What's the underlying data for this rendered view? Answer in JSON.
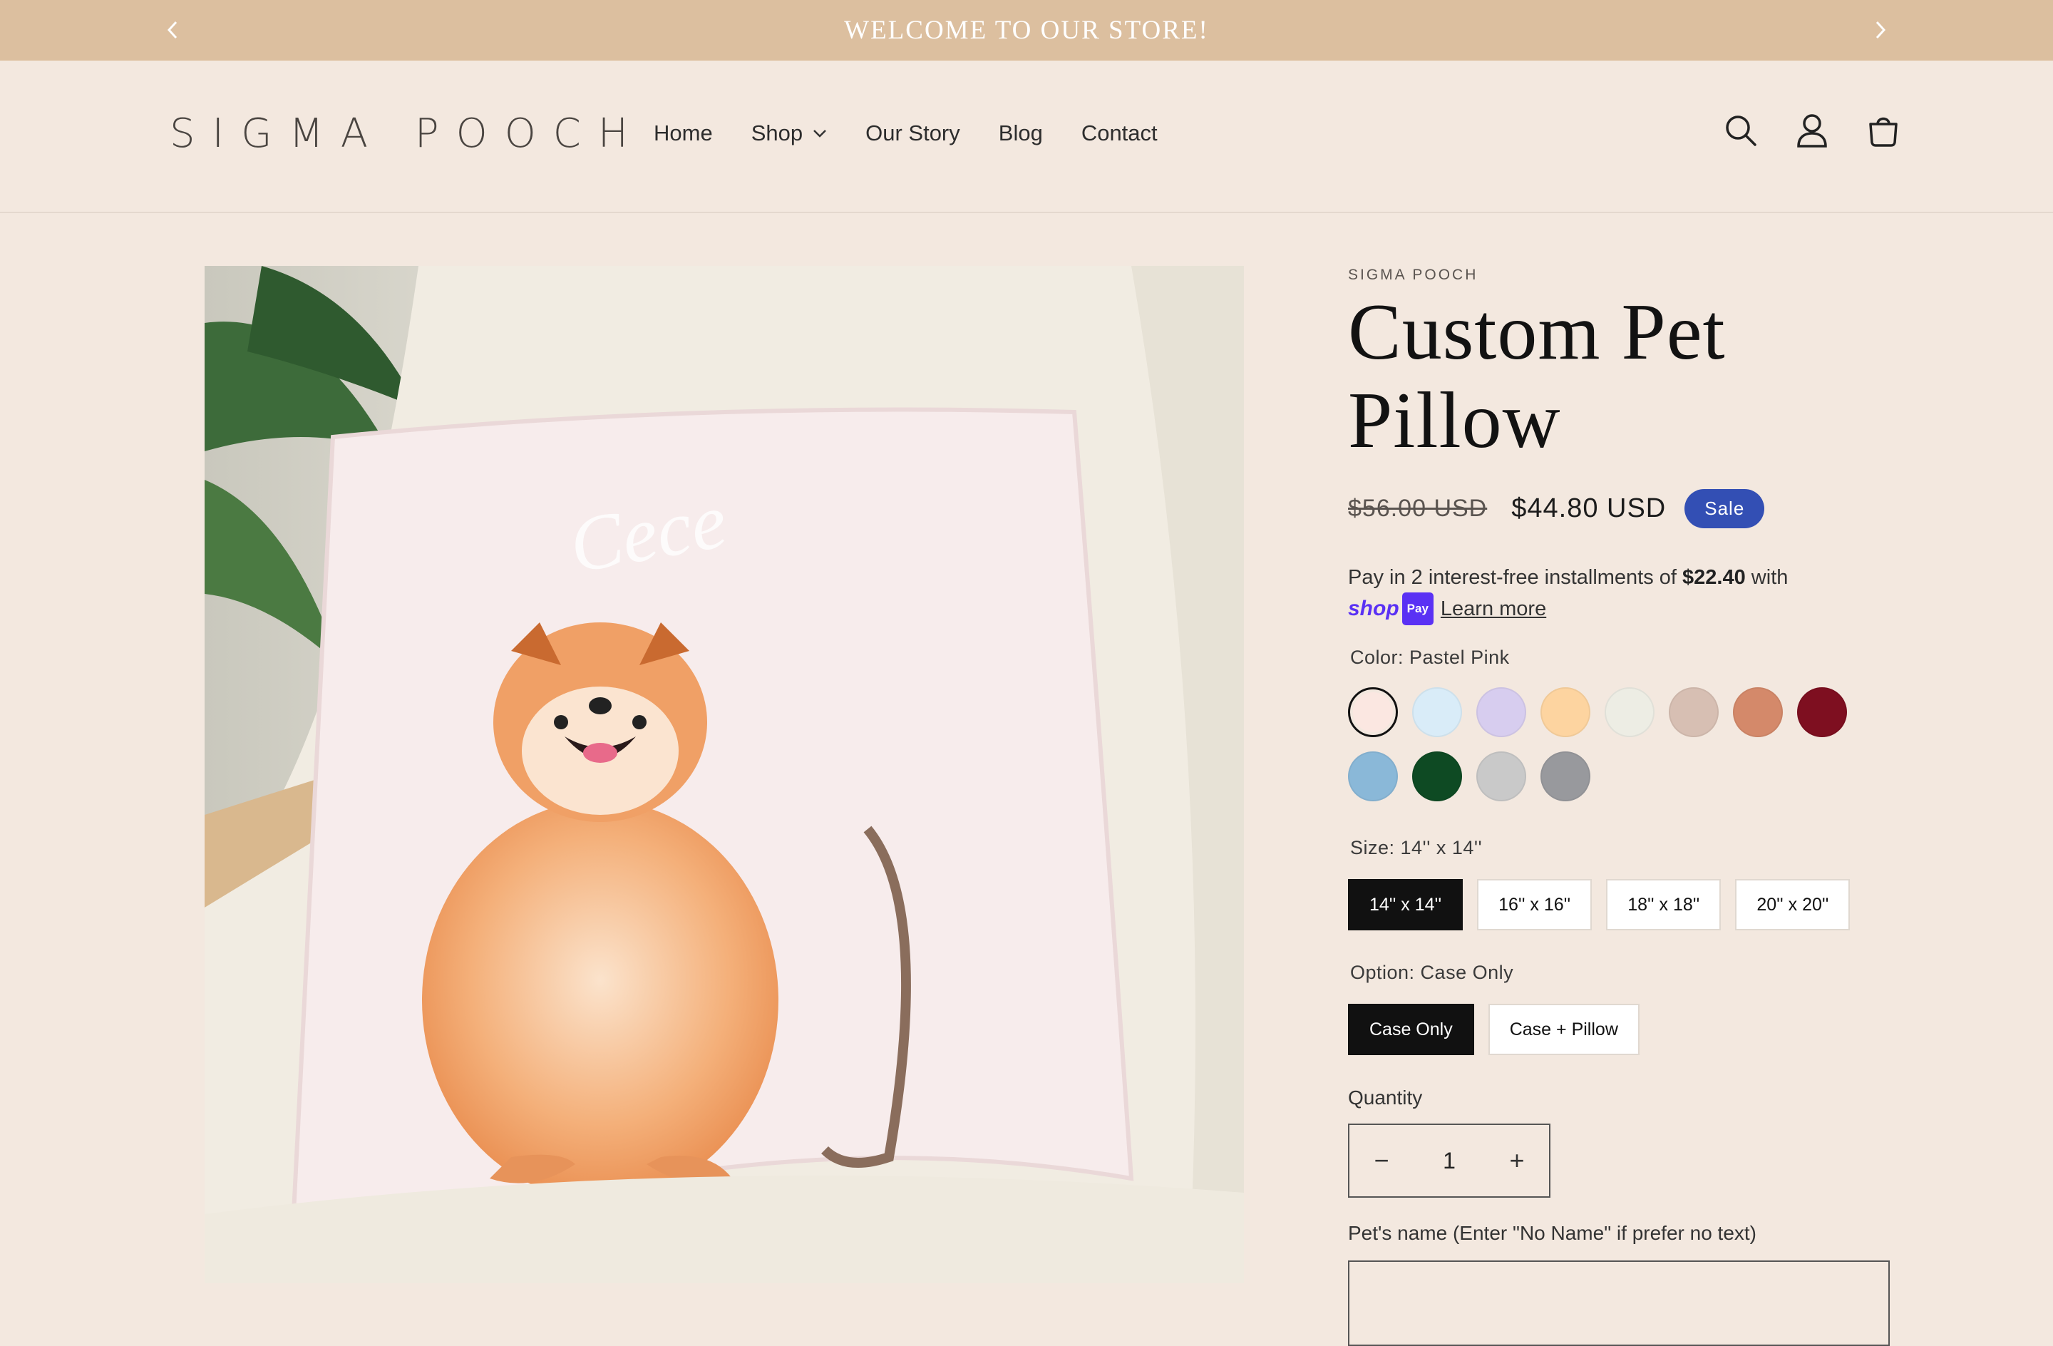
{
  "announcement": {
    "text": "WELCOME TO OUR STORE!"
  },
  "header": {
    "logo": "SIGMA POOCH",
    "nav": [
      "Home",
      "Shop",
      "Our Story",
      "Blog",
      "Contact"
    ]
  },
  "product": {
    "vendor": "SIGMA POOCH",
    "title": "Custom Pet Pillow",
    "price_old": "$56.00 USD",
    "price_new": "$44.80 USD",
    "sale_badge": "Sale",
    "installments_prefix": "Pay in 2 interest-free installments of ",
    "installments_amount": "$22.40",
    "installments_suffix": " with",
    "shop_pay_word": "shop",
    "shop_pay_box": "Pay",
    "learn_more": "Learn more",
    "color": {
      "label": "Color: Pastel Pink",
      "selected_index": 0,
      "swatches": [
        "#fbe7e1",
        "#d9ecf8",
        "#d7cdef",
        "#fdd4a0",
        "#edede4",
        "#d7bfb3",
        "#d4896a",
        "#7e0f20",
        "#8ab8d8",
        "#0e4a23",
        "#c9c9c9",
        "#98999d"
      ]
    },
    "size": {
      "label": "Size: 14'' x 14''",
      "options": [
        "14'' x 14''",
        "16'' x 16''",
        "18'' x 18''",
        "20'' x 20''"
      ],
      "selected_index": 0
    },
    "option": {
      "label": "Option: Case Only",
      "options": [
        "Case Only",
        "Case + Pillow"
      ],
      "selected_index": 0
    },
    "quantity": {
      "label": "Quantity",
      "value": "1",
      "minus": "−",
      "plus": "+"
    },
    "pet_name": {
      "label": "Pet's name (Enter \"No Name\" if prefer no text)",
      "value": ""
    },
    "image_pet_name": "Cece"
  },
  "colors": {
    "accent": "#334fb4",
    "announcement_bg": "#dcbf9f",
    "page_bg": "#f3e8df"
  }
}
